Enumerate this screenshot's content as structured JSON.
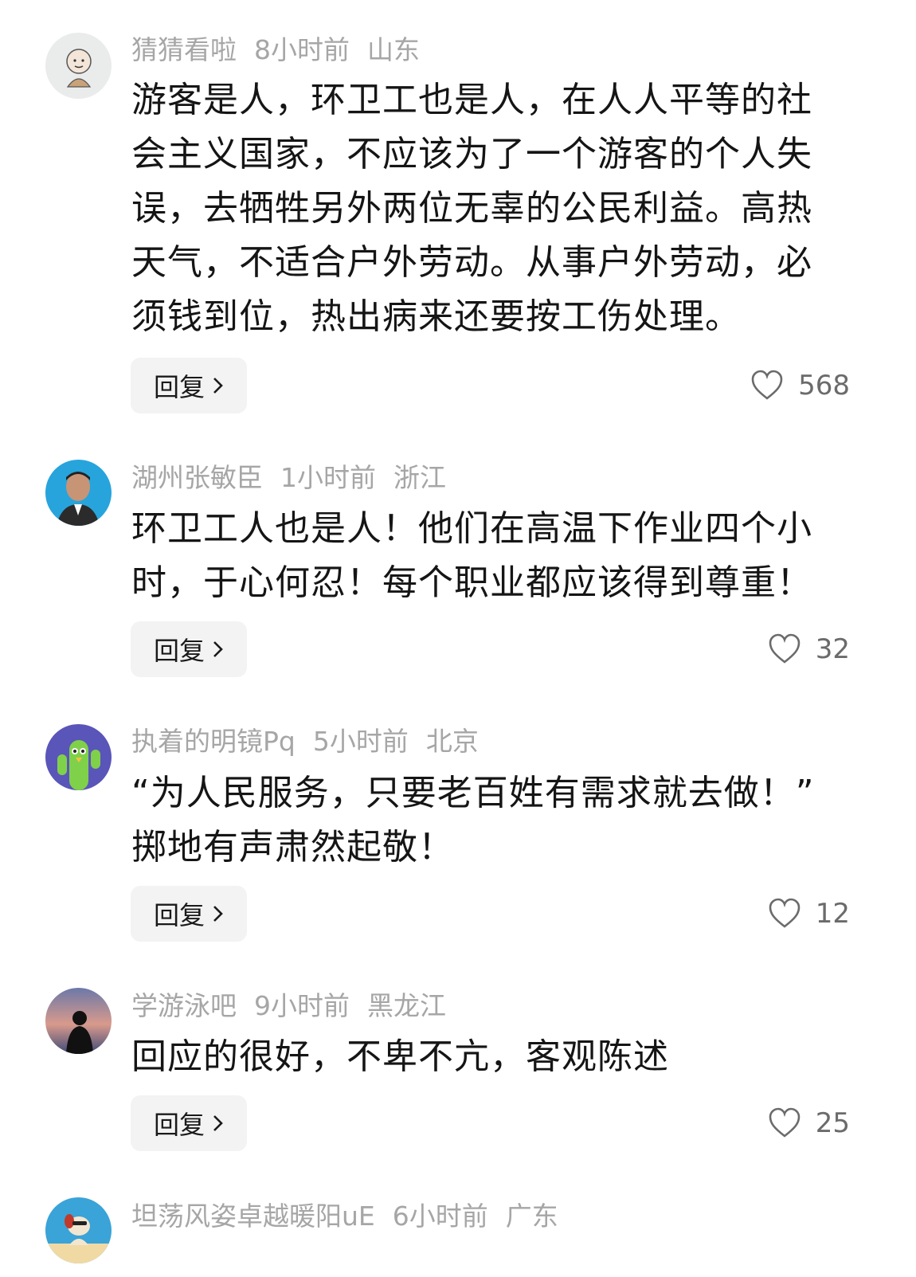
{
  "comments": [
    {
      "user": "猜猜看啦",
      "time": "8小时前",
      "location": "山东",
      "lines": [
        "游客是人，环卫工也是人，在人人平等的社",
        "会主义国家，不应该为了一个游客的个人失",
        "误，去牺牲另外两位无辜的公民利益。高热",
        "天气，不适合户外劳动。从事户外劳动，必",
        "须钱到位，热出病来还要按工伤处理。"
      ],
      "reply_label": "回复",
      "likes": "568",
      "avatar_icon": "cartoon-monk-avatar"
    },
    {
      "user": "湖州张敏臣",
      "time": "1小时前",
      "location": "浙江",
      "lines": [
        "环卫工人也是人！他们在高温下作业四个小",
        "时，于心何忍！每个职业都应该得到尊重！"
      ],
      "reply_label": "回复",
      "likes": "32",
      "avatar_icon": "portrait-photo-avatar"
    },
    {
      "user": "执着的明镜Pq",
      "time": "5小时前",
      "location": "北京",
      "lines": [
        "“为人民服务，只要老百姓有需求就去做！”",
        "掷地有声肃然起敬！"
      ],
      "reply_label": "回复",
      "likes": "12",
      "avatar_icon": "cactus-cartoon-avatar"
    },
    {
      "user": "学游泳吧",
      "time": "9小时前",
      "location": "黑龙江",
      "lines": [
        "回应的很好，不卑不亢，客观陈述"
      ],
      "reply_label": "回复",
      "likes": "25",
      "avatar_icon": "sunset-silhouette-avatar"
    },
    {
      "user": "坦荡风姿卓越暖阳uE",
      "time": "6小时前",
      "location": "广东",
      "lines": [],
      "avatar_icon": "dog-on-beach-avatar"
    }
  ],
  "colors": {
    "meta_text": "#a6a6a6",
    "body_text": "#151515",
    "reply_bg": "#f3f3f3",
    "like_text": "#6b6b6b"
  }
}
